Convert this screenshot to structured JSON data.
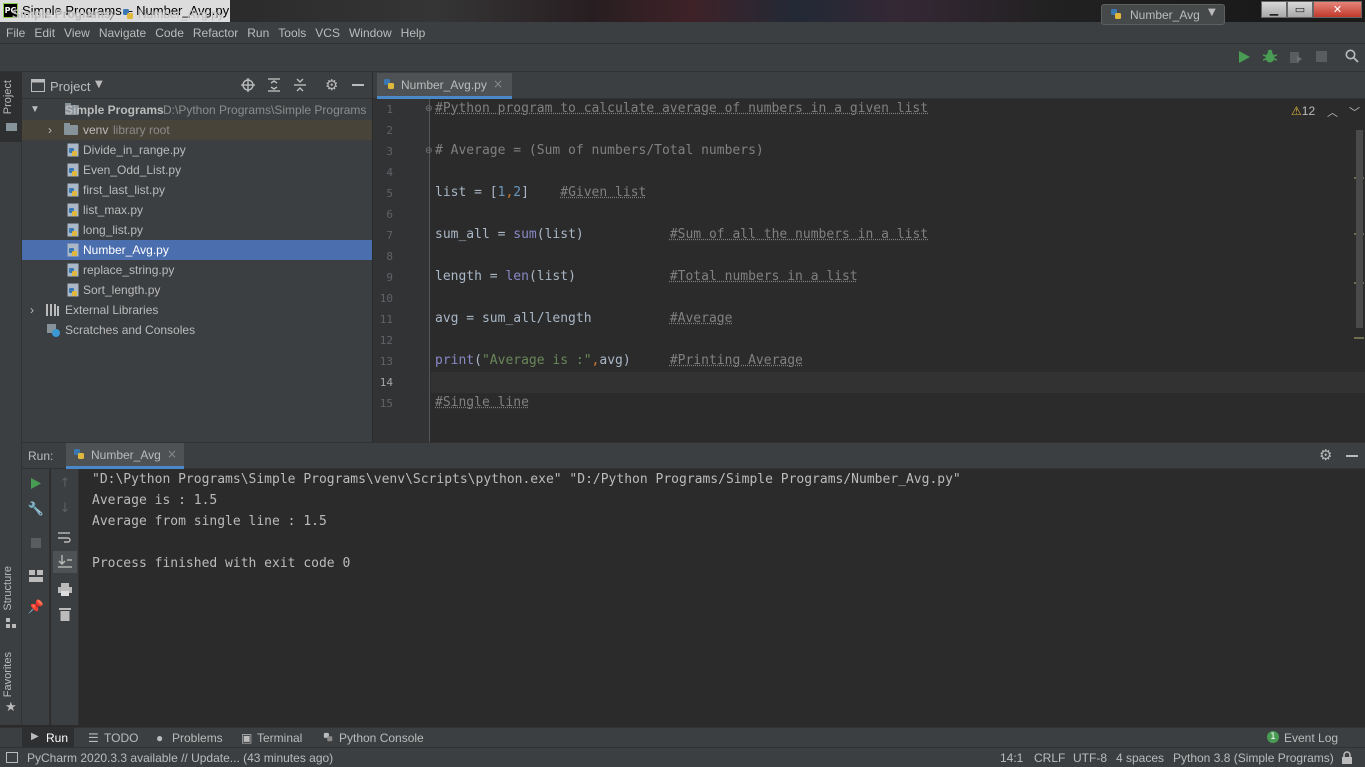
{
  "window": {
    "title": "Simple Programs – Number_Avg.py",
    "app_icon": "PC",
    "minimize": "▁",
    "maximize": "▭",
    "close": "✕"
  },
  "menu": [
    "File",
    "Edit",
    "View",
    "Navigate",
    "Code",
    "Refactor",
    "Run",
    "Tools",
    "VCS",
    "Window",
    "Help"
  ],
  "navbar": {
    "project": "Simple Programs",
    "separator": "〉",
    "file": "Number_Avg.py",
    "run_config": "Number_Avg"
  },
  "left_strip": {
    "project": "Project",
    "structure": "Structure",
    "favorites": "Favorites"
  },
  "project_panel": {
    "title": "Project",
    "root_name": "Simple Programs",
    "root_path": "D:\\Python Programs\\Simple Programs",
    "venv": "venv",
    "venv_note": "library root",
    "files": [
      "Divide_in_range.py",
      "Even_Odd_List.py",
      "first_last_list.py",
      "list_max.py",
      "long_list.py",
      "Number_Avg.py",
      "replace_string.py",
      "Sort_length.py"
    ],
    "external": "External Libraries",
    "scratches": "Scratches and Consoles"
  },
  "editor": {
    "tab": "Number_Avg.py",
    "warnings": "12",
    "line_numbers": [
      "1",
      "2",
      "3",
      "4",
      "5",
      "6",
      "7",
      "8",
      "9",
      "10",
      "11",
      "12",
      "13",
      "14",
      "15"
    ],
    "lines": {
      "l1": "#Python program to calculate average of numbers in a given list",
      "l3": "# Average = (Sum of numbers/Total numbers)",
      "l5_code": "list = [",
      "l5_n1": "1",
      "l5_comma": ",",
      "l5_n2": "2",
      "l5_close": "]",
      "l5_comment": "#Given list",
      "l7_a": "sum_all = ",
      "l7_fn": "sum",
      "l7_b": "(list)",
      "l7_comment": "#Sum of all the numbers in a list",
      "l9_a": "length = ",
      "l9_fn": "len",
      "l9_b": "(list)",
      "l9_comment": "#Total numbers in a list",
      "l11": "avg = sum_all/length",
      "l11_comment": "#Average",
      "l13_fn": "print",
      "l13_open": "(",
      "l13_str": "\"Average is :\"",
      "l13_comma": ",",
      "l13_rest": "avg)",
      "l13_comment": "#Printing Average",
      "l15": "#Single line"
    }
  },
  "run_panel": {
    "label": "Run:",
    "tab": "Number_Avg",
    "output": [
      "\"D:\\Python Programs\\Simple Programs\\venv\\Scripts\\python.exe\" \"D:/Python Programs/Simple Programs/Number_Avg.py\"",
      "Average is : 1.5",
      "Average from single line : 1.5",
      "",
      "Process finished with exit code 0"
    ]
  },
  "bottom_tabs": {
    "run": "Run",
    "todo": "TODO",
    "problems": "Problems",
    "terminal": "Terminal",
    "python_console": "Python Console",
    "event_log": "Event Log",
    "event_count": "1"
  },
  "status": {
    "message": "PyCharm 2020.3.3 available // Update... (43 minutes ago)",
    "position": "14:1",
    "line_sep": "CRLF",
    "encoding": "UTF-8",
    "indent": "4 spaces",
    "interpreter": "Python 3.8 (Simple Programs)"
  },
  "colors": {
    "accent": "#4a88c7",
    "selection": "#4b6eaf",
    "run_green": "#499c54"
  }
}
